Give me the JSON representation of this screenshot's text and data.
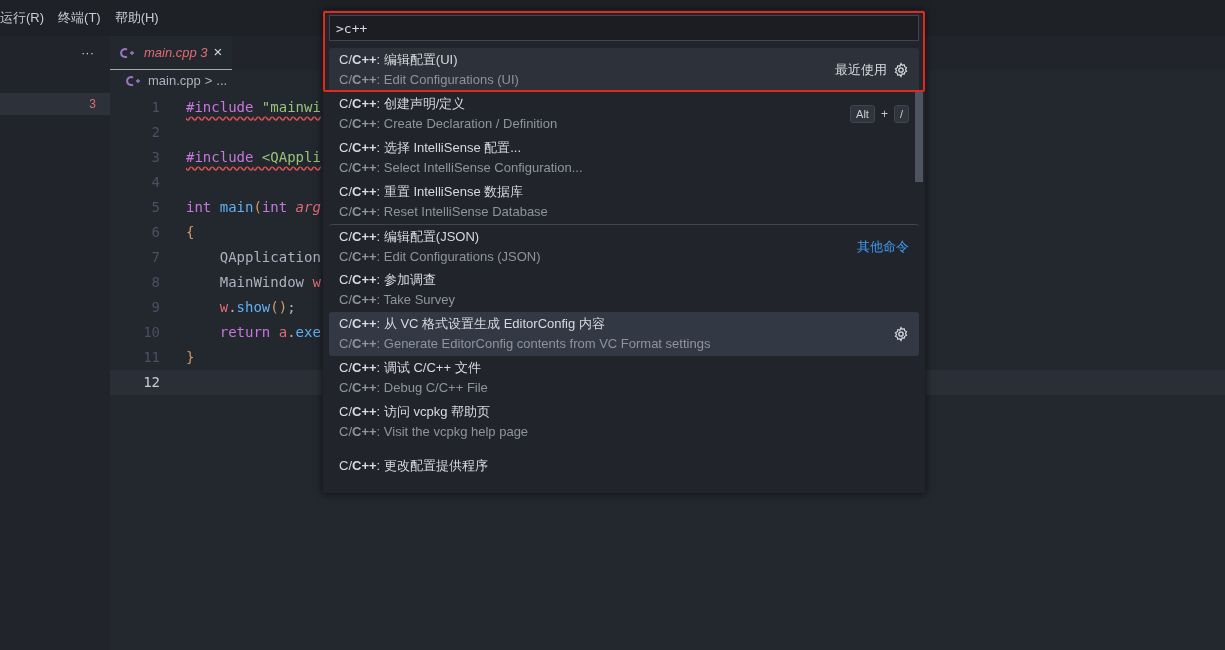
{
  "menu": [
    "运行(R)",
    "终端(T)",
    "帮助(H)"
  ],
  "sidebar": {
    "more": "···",
    "rows": [
      {
        "badge": "3",
        "selected": true
      }
    ]
  },
  "tabs": [
    {
      "label": "main.cpp",
      "problems": "3",
      "close": "×",
      "selected": true,
      "error": true
    }
  ],
  "breadcrumbs": {
    "file": "main.cpp",
    "separator": ">",
    "rest": "..."
  },
  "editor": {
    "lines": [
      {
        "number": "1",
        "current": false,
        "squiggle": true,
        "indent": false,
        "tokens": [
          {
            "text": "#include",
            "kind": "keyword"
          },
          {
            "text": " \"mainwi",
            "kind": "string"
          }
        ]
      },
      {
        "number": "2",
        "current": false
      },
      {
        "number": "3",
        "current": false,
        "squiggle": true,
        "indent": false,
        "tokens": [
          {
            "text": "#include",
            "kind": "keyword"
          },
          {
            "text": " <QAppli",
            "kind": "string"
          }
        ]
      },
      {
        "number": "4",
        "current": false
      },
      {
        "number": "5",
        "current": false,
        "squiggle": false,
        "indent": false,
        "tokens": [
          {
            "text": "int",
            "kind": "keyword"
          },
          {
            "text": " main",
            "kind": "function"
          },
          {
            "text": "(",
            "kind": "brace"
          },
          {
            "text": "int",
            "kind": "keyword"
          },
          {
            "text": " arg",
            "kind": "param"
          }
        ]
      },
      {
        "number": "6",
        "current": false,
        "squiggle": false,
        "indent": false,
        "tokens": [
          {
            "text": "{",
            "kind": "brace"
          }
        ]
      },
      {
        "number": "7",
        "current": false,
        "squiggle": false,
        "indent": true,
        "tokens": [
          {
            "text": "QApplication",
            "kind": "plain"
          }
        ]
      },
      {
        "number": "8",
        "current": false,
        "squiggle": false,
        "indent": true,
        "tokens": [
          {
            "text": "MainWindow",
            "kind": "plain"
          },
          {
            "text": " w",
            "kind": "variable"
          }
        ]
      },
      {
        "number": "9",
        "current": false,
        "squiggle": false,
        "indent": true,
        "tokens": [
          {
            "text": "w",
            "kind": "variable"
          },
          {
            "text": ".",
            "kind": "plain"
          },
          {
            "text": "show",
            "kind": "function"
          },
          {
            "text": "()",
            "kind": "brace"
          },
          {
            "text": ";",
            "kind": "plain"
          }
        ]
      },
      {
        "number": "10",
        "current": false,
        "squiggle": false,
        "indent": true,
        "tokens": [
          {
            "text": "return",
            "kind": "keyword"
          },
          {
            "text": " a",
            "kind": "variable"
          },
          {
            "text": ".",
            "kind": "plain"
          },
          {
            "text": "exe",
            "kind": "function"
          }
        ]
      },
      {
        "number": "11",
        "current": false,
        "squiggle": false,
        "indent": false,
        "tokens": [
          {
            "text": "}",
            "kind": "brace"
          }
        ]
      },
      {
        "number": "12",
        "current": true
      }
    ]
  },
  "command_palette": {
    "query": ">c++",
    "annotation_frame": true,
    "items": [
      {
        "label": "C/**C++**: 编辑配置(UI)",
        "detail": "C/**C++**: Edit Configurations (UI)",
        "selected": true,
        "hovered": false,
        "separator_before": false,
        "group": "最近使用",
        "group_link": false,
        "gear": true
      },
      {
        "label": "C/**C++**: 创建声明/定义",
        "detail": "C/**C++**: Create Declaration / Definition",
        "selected": false,
        "hovered": false,
        "separator_before": false,
        "keys": [
          "Alt",
          "+",
          "/"
        ],
        "gear": false
      },
      {
        "label": "C/**C++**: 选择 IntelliSense 配置...",
        "detail": "C/**C++**: Select IntelliSense Configuration...",
        "selected": false,
        "hovered": false,
        "separator_before": false,
        "gear": false
      },
      {
        "label": "C/**C++**: 重置 IntelliSense 数据库",
        "detail": "C/**C++**: Reset IntelliSense Database",
        "selected": false,
        "hovered": false,
        "separator_before": false,
        "gear": false
      },
      {
        "label": "C/**C++**: 编辑配置(JSON)",
        "detail": "C/**C++**: Edit Configurations (JSON)",
        "selected": false,
        "hovered": false,
        "separator_before": true,
        "group": "其他命令",
        "group_link": true,
        "gear": false
      },
      {
        "label": "C/**C++**: 参加调查",
        "detail": "C/**C++**: Take Survey",
        "selected": false,
        "hovered": false,
        "separator_before": false,
        "gear": false
      },
      {
        "label": "C/**C++**: 从 VC 格式设置生成 EditorConfig 内容",
        "detail": "C/**C++**: Generate EditorConfig contents from VC Format settings",
        "selected": false,
        "hovered": true,
        "separator_before": false,
        "gear": true
      },
      {
        "label": "C/**C++**: 调试 C/C++ 文件",
        "detail": "C/**C++**: Debug C/C++ File",
        "selected": false,
        "hovered": false,
        "separator_before": false,
        "gear": false
      },
      {
        "label": "C/**C++**: 访问 vcpkg 帮助页",
        "detail": "C/**C++**: Visit the vcpkg help page",
        "selected": false,
        "hovered": false,
        "separator_before": false,
        "gear": false
      },
      {
        "label": "C/**C++**: 更改配置提供程序",
        "selected": false,
        "hovered": false,
        "separator_before": false,
        "gear": false
      }
    ]
  }
}
